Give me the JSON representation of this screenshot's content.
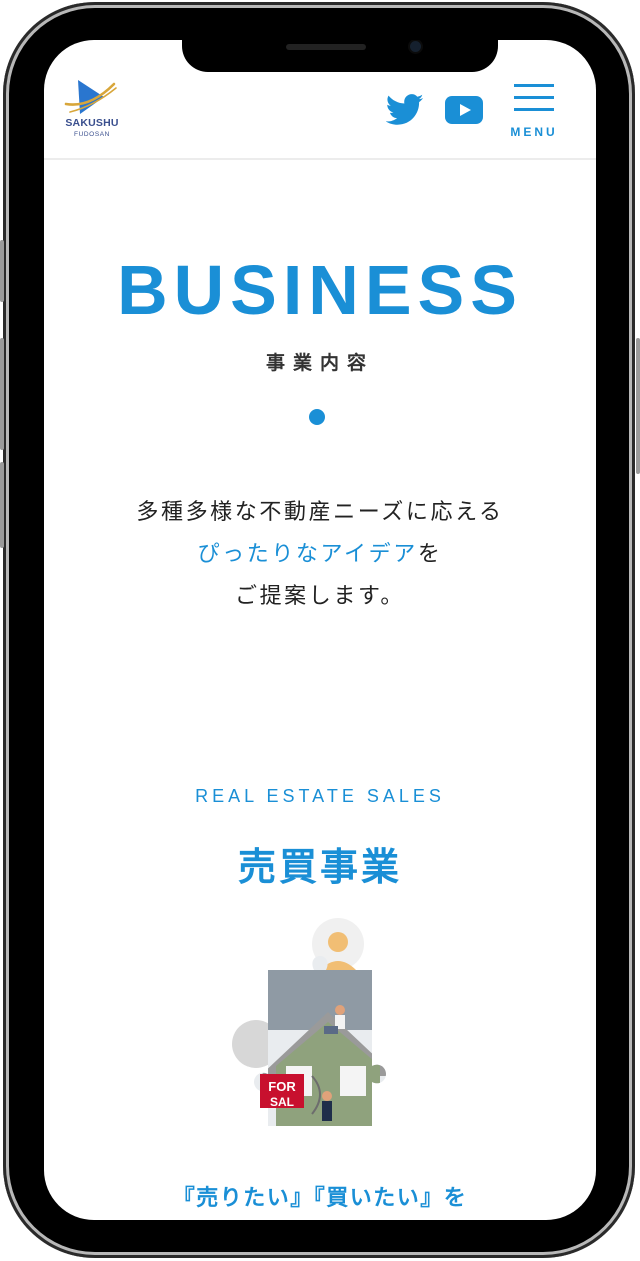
{
  "brand": {
    "name": "SAKUSHU",
    "sub": "FUDOSAN"
  },
  "header": {
    "social": [
      {
        "name": "twitter-icon"
      },
      {
        "name": "youtube-icon"
      }
    ],
    "menu_label": "MENU"
  },
  "hero": {
    "title": "BUSINESS",
    "subtitle": "事業内容"
  },
  "lead": {
    "line1": "多種多様な不動産ニーズに応える",
    "line2_accent": "ぴったりなアイデア",
    "line2_tail": "を",
    "line3": "ご提案します。"
  },
  "section": {
    "label_en": "REAL ESTATE SALES",
    "label_jp": "売買事業",
    "sign_text_1": "FOR",
    "sign_text_2": "SAL",
    "bottom_text": "『売りたい』『買いたい』を"
  },
  "colors": {
    "accent": "#1a8fd6",
    "text": "#222222",
    "logo_navy": "#3a4f8e",
    "logo_gold": "#d8a63a"
  }
}
